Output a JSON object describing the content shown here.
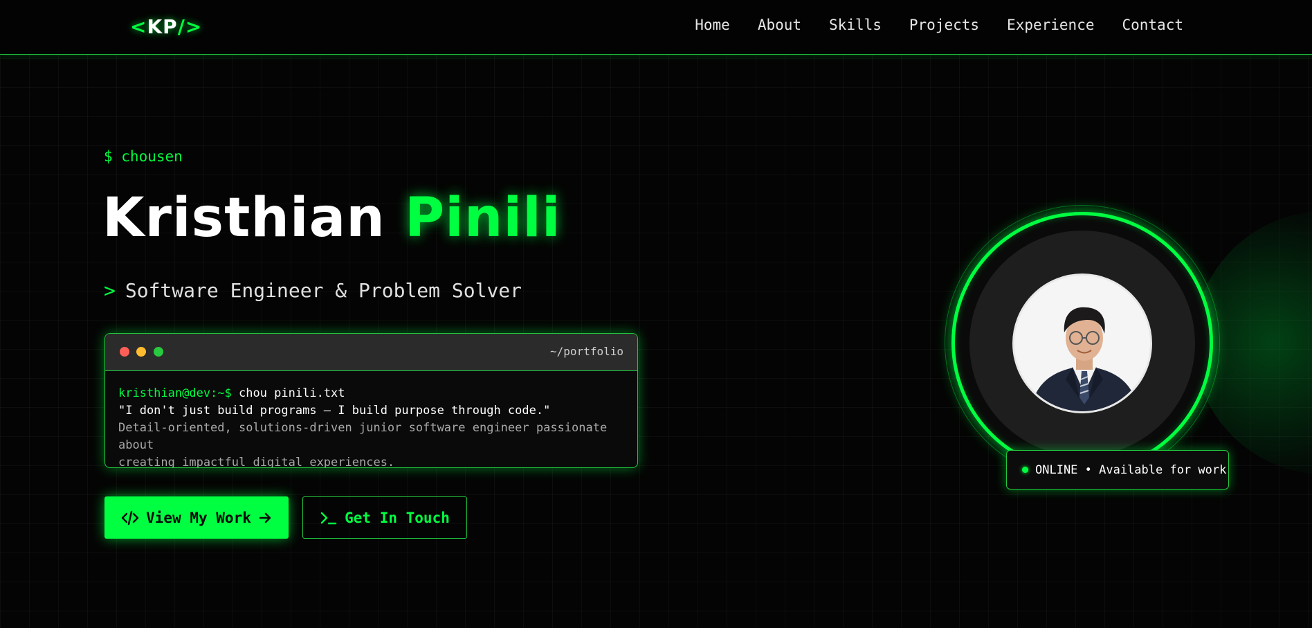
{
  "nav": {
    "logo_left": "<",
    "logo_mid": "KP",
    "logo_right": "/>",
    "links": [
      "Home",
      "About",
      "Skills",
      "Projects",
      "Experience",
      "Contact"
    ]
  },
  "hero": {
    "prompt": "$ chousen",
    "name_first": "Kristhian ",
    "name_last": "Pinili",
    "subtitle_arrow": ">",
    "subtitle": "Software Engineer & Problem Solver"
  },
  "terminal": {
    "path": "~/portfolio",
    "user": "kristhian@dev:~$",
    "command": " chou pinili.txt",
    "quote": "\"I don't just build programs — I build purpose through code.\"",
    "description_line1": "Detail-oriented, solutions-driven junior software engineer passionate about",
    "description_line2": "creating impactful digital experiences."
  },
  "buttons": {
    "primary_label": "View My Work",
    "secondary_label": "Get In Touch"
  },
  "status": {
    "label": "ONLINE • Available for work"
  },
  "colors": {
    "accent": "#00ff41",
    "background": "#040404",
    "terminal_bar": "#2b2b2b"
  },
  "icons": {
    "primary_left": "code-icon",
    "primary_right": "arrow-right-icon",
    "secondary_left": "terminal-icon"
  }
}
